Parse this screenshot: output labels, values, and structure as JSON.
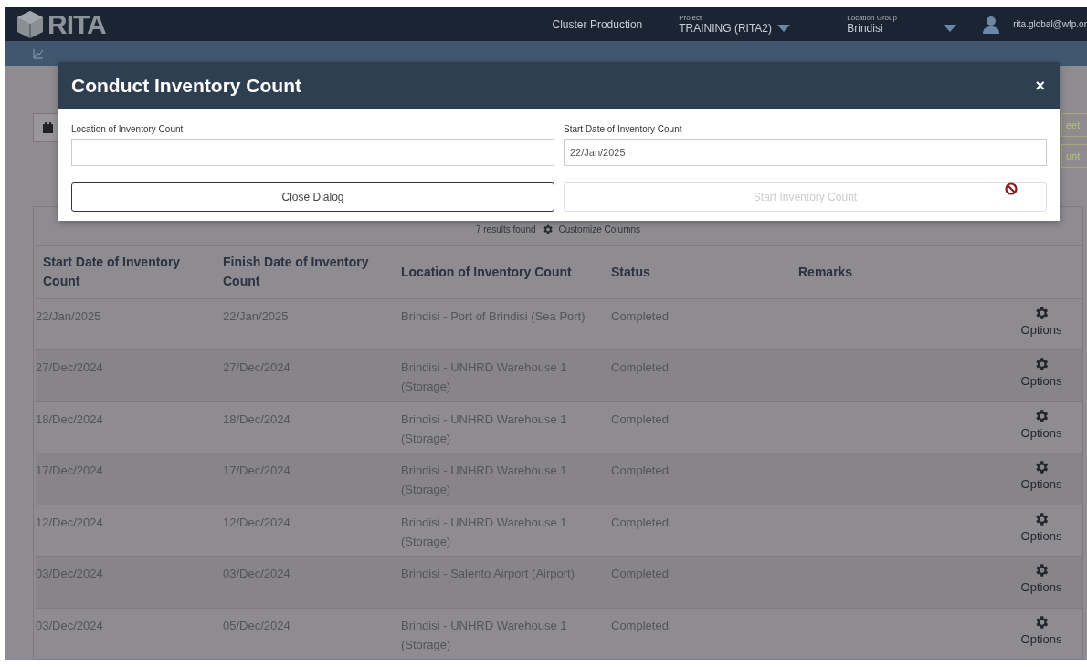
{
  "header": {
    "logo": "RITA",
    "cluster": "Cluster Production",
    "project": {
      "label": "Project",
      "value": "TRAINING (RITA2)"
    },
    "location_group": {
      "label": "Location Group",
      "value": "Brindisi"
    },
    "user": "rita.global@wfp.or"
  },
  "toolbar": {
    "buttons": [
      {
        "label": "eet",
        "disabled": false
      },
      {
        "label": "unt",
        "disabled": false
      }
    ]
  },
  "results": {
    "count": "7 results found",
    "customize": "Customize Columns"
  },
  "table": {
    "columns": [
      "Start Date of Inventory Count",
      "Finish Date of Inventory Count",
      "Location of Inventory Count",
      "Status",
      "Remarks"
    ],
    "rows": [
      {
        "start": "22/Jan/2025",
        "finish": "22/Jan/2025",
        "location": "Brindisi - Port of Brindisi (Sea Port)",
        "status": "Completed",
        "options": "Options"
      },
      {
        "start": "27/Dec/2024",
        "finish": "27/Dec/2024",
        "location": "Brindisi - UNHRD Warehouse 1 (Storage)",
        "status": "Completed",
        "options": "Options"
      },
      {
        "start": "18/Dec/2024",
        "finish": "18/Dec/2024",
        "location": "Brindisi - UNHRD Warehouse 1 (Storage)",
        "status": "Completed",
        "options": "Options"
      },
      {
        "start": "17/Dec/2024",
        "finish": "17/Dec/2024",
        "location": "Brindisi - UNHRD Warehouse 1 (Storage)",
        "status": "Completed",
        "options": "Options"
      },
      {
        "start": "12/Dec/2024",
        "finish": "12/Dec/2024",
        "location": "Brindisi - UNHRD Warehouse 1 (Storage)",
        "status": "Completed",
        "options": "Options"
      },
      {
        "start": "03/Dec/2024",
        "finish": "03/Dec/2024",
        "location": "Brindisi - Salento Airport (Airport)",
        "status": "Completed",
        "options": "Options"
      },
      {
        "start": "03/Dec/2024",
        "finish": "05/Dec/2024",
        "location": "Brindisi - UNHRD Warehouse 1 (Storage)",
        "status": "Completed",
        "options": "Options"
      }
    ]
  },
  "dialog": {
    "title": "Conduct Inventory Count",
    "close": "×",
    "fields": [
      {
        "label": "Location of Inventory Count"
      },
      {
        "label": "Start Date of Inventory Count",
        "value": "22/Jan/2025"
      }
    ],
    "buttons": [
      {
        "label": "Close Dialog",
        "disabled": false
      },
      {
        "label": "Start Inventory Count",
        "disabled": true
      }
    ]
  }
}
